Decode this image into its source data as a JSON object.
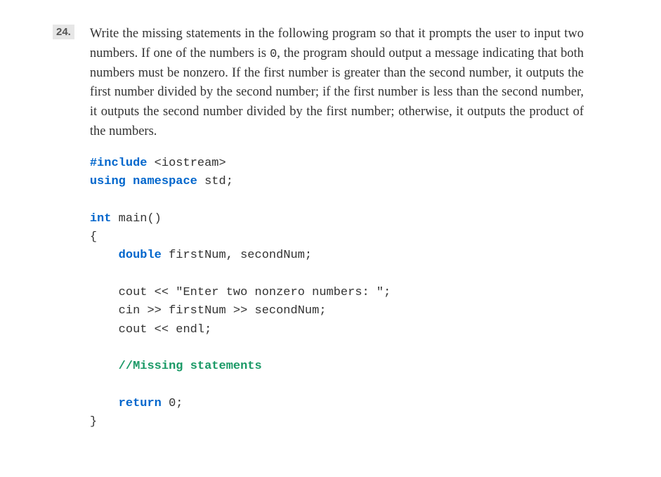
{
  "problem": {
    "number": "24.",
    "text_parts": {
      "p1": "Write the missing statements in the following program so that it prompts the user to input two numbers. If one of the numbers is ",
      "code1": "0",
      "p2": ", the program should output a message indicating that both numbers must be nonzero. If the first number is greater than the second number, it outputs the first number divided by the second number; if the first number is less than the second number, it outputs the second number divided by the first number; otherwise, it outputs the product of the numbers."
    }
  },
  "code": {
    "include_directive": "#include",
    "include_header": " <iostream>",
    "using": "using namespace",
    "using_val": " std;",
    "int_kw": "int",
    "main_sig": " main()",
    "brace_open": "{",
    "double_kw": "double",
    "double_decl": " firstNum, secondNum;",
    "cout1": "    cout << \"Enter two nonzero numbers: \";",
    "cin1": "    cin >> firstNum >> secondNum;",
    "cout2": "    cout << endl;",
    "comment": "//Missing statements",
    "return_kw": "return",
    "return_val": " 0;",
    "brace_close": "}"
  }
}
